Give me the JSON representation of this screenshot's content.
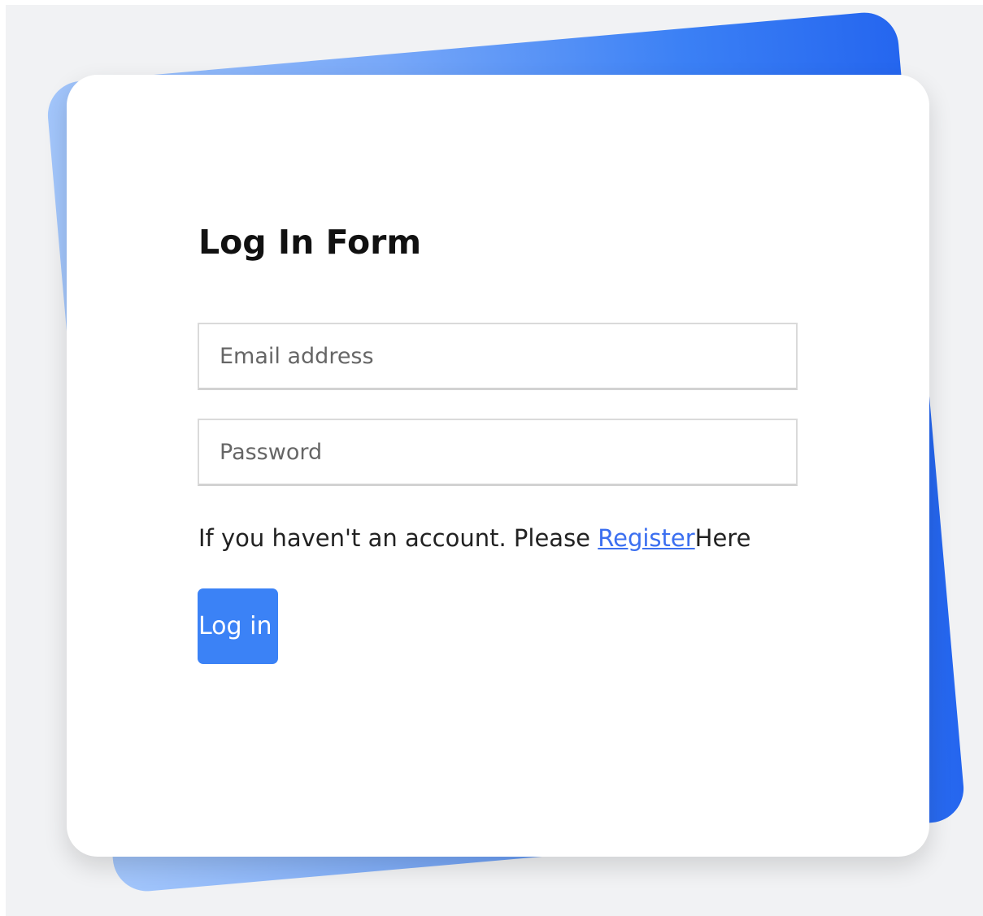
{
  "form": {
    "title": "Log In Form",
    "email_placeholder": "Email address",
    "password_placeholder": "Password",
    "register_prefix": "If you haven't an account. Please ",
    "register_link": "Register",
    "register_suffix": "Here",
    "login_button": "Log in"
  },
  "colors": {
    "page_background": "#f1f2f4",
    "card_background": "#ffffff",
    "accent": "#3b82f6",
    "link": "#3b6ff0",
    "backdrop_gradient_start": "#a3c6fb",
    "backdrop_gradient_end": "#2566ef"
  }
}
